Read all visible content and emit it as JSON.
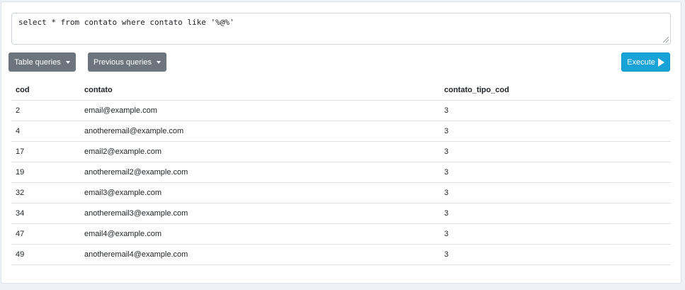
{
  "query": {
    "text": "select * from contato where contato like '%@%'"
  },
  "toolbar": {
    "table_queries_label": "Table queries",
    "previous_queries_label": "Previous queries",
    "execute_label": "Execute"
  },
  "results": {
    "columns": [
      "cod",
      "contato",
      "contato_tipo_cod"
    ],
    "rows": [
      [
        "2",
        "email@example.com",
        "3"
      ],
      [
        "4",
        "anotheremail@example.com",
        "3"
      ],
      [
        "17",
        "email2@example.com",
        "3"
      ],
      [
        "19",
        "anotheremail2@example.com",
        "3"
      ],
      [
        "32",
        "email3@example.com",
        "3"
      ],
      [
        "34",
        "anotheremail3@example.com",
        "3"
      ],
      [
        "47",
        "email4@example.com",
        "3"
      ],
      [
        "49",
        "anotheremail4@example.com",
        "3"
      ]
    ]
  },
  "colors": {
    "secondary": "#6c757d",
    "primary": "#17a2d8",
    "border": "#dee2e6"
  },
  "icons": {
    "dropdown": "caret-down-icon",
    "execute": "play-icon"
  }
}
